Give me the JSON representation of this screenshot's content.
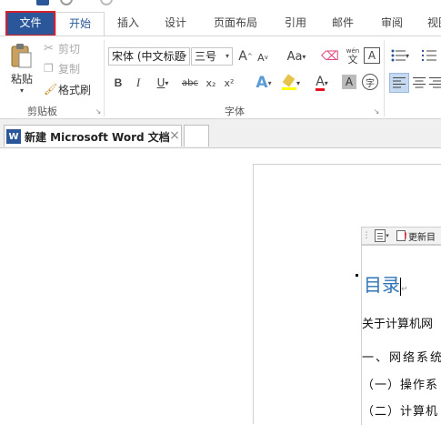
{
  "ribbon_tabs": [
    {
      "label": "文件"
    },
    {
      "label": "开始"
    },
    {
      "label": "插入"
    },
    {
      "label": "设计"
    },
    {
      "label": "页面布局"
    },
    {
      "label": "引用"
    },
    {
      "label": "邮件"
    },
    {
      "label": "审阅"
    },
    {
      "label": "视图"
    }
  ],
  "clipboard": {
    "paste_label": "粘贴",
    "cut_label": "剪切",
    "copy_label": "复制",
    "format_painter_label": "格式刷",
    "group_label": "剪贴板"
  },
  "font": {
    "font_name": "宋体 (中文标题",
    "font_size": "三号",
    "group_label": "字体",
    "grow": "A",
    "shrink": "A",
    "case": "Aa",
    "bold": "B",
    "italic": "I",
    "underline": "U",
    "strike": "abc",
    "subscript": "x₂",
    "superscript": "x²",
    "text_effect": "A",
    "font_color": "A",
    "char_shading": "A",
    "enclose": "字",
    "phonetic": "wén",
    "char_border": "A"
  },
  "document_tab": {
    "title": "新建 Microsoft Word 文档",
    "close": "×"
  },
  "document": {
    "toc_toolbar_update": "更新目",
    "toc_title": "目录",
    "lines": [
      "关于计算机网",
      "一、网络系统",
      "（一）操作系",
      "（二）计算机"
    ]
  },
  "colors": {
    "file_tab_bg": "#2b579a",
    "file_tab_border": "#d4202a",
    "accent": "#2b579a",
    "toc_title": "#2e74b5",
    "highlight": "#ffff00",
    "font_color": "#e81123"
  }
}
